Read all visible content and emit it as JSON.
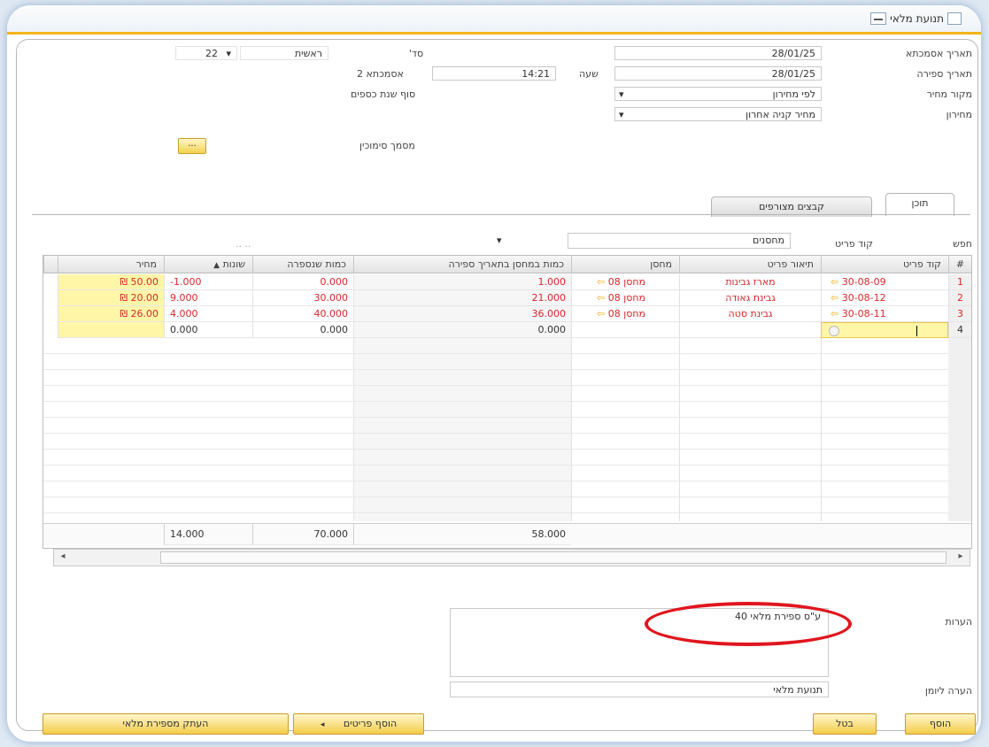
{
  "window": {
    "title": "תנועת מלאי"
  },
  "header": {
    "posting_date_label": "תאריך אסמכתא",
    "posting_date": "28/01/25",
    "count_date_label": "תאריך ספירה",
    "count_date": "28/01/25",
    "price_source_label": "מקור מחיר",
    "price_source": "לפי מחירון",
    "price_list_label": "מחירון",
    "price_list": "מחיר קניה אחרון",
    "time_label": "שעה",
    "time": "14:21",
    "series_label": "סד'",
    "series_value": "ראשית",
    "number": "22",
    "ref2_label": "אסמכתא 2",
    "fiscal_close": "סוף שנת כספים",
    "doc_ref_label": "מסמך סימוכין",
    "ellipsis": "..."
  },
  "tabs": [
    {
      "label": "תוכן"
    },
    {
      "label": "קבצים מצורפים"
    }
  ],
  "filter": {
    "find_label": "חפש",
    "item_code_label": "קוד פריט",
    "warehouses_label": "מחסנים",
    "dots": ".. .."
  },
  "grid": {
    "columns": {
      "num": "#",
      "item_code": "קוד פריט",
      "description": "תיאור פריט",
      "warehouse": "מחסן",
      "qty_on_date": "כמות במחסן בתאריך ספירה",
      "counted": "כמות שנספרה",
      "variance": "שונות",
      "price": "מחיר"
    },
    "rows": [
      {
        "num": "1",
        "item_code": "30-08-09",
        "description": "מארז גבינות",
        "warehouse": "מחסן 08",
        "qty_on_date": "1.000",
        "counted": "0.000",
        "variance": "-1.000",
        "price": "₪ 50.00"
      },
      {
        "num": "2",
        "item_code": "30-08-12",
        "description": "גבינת גאודה",
        "warehouse": "מחסן 08",
        "qty_on_date": "21.000",
        "counted": "30.000",
        "variance": "9.000",
        "price": "₪ 20.00"
      },
      {
        "num": "3",
        "item_code": "30-08-11",
        "description": "גבינת סטה",
        "warehouse": "מחסן 08",
        "qty_on_date": "36.000",
        "counted": "40.000",
        "variance": "4.000",
        "price": "₪ 26.00"
      },
      {
        "num": "4",
        "item_code": "",
        "description": "",
        "warehouse": "",
        "qty_on_date": "0.000",
        "counted": "0.000",
        "variance": "0.000",
        "price": ""
      }
    ],
    "totals": {
      "qty_on_date": "58.000",
      "counted": "70.000",
      "variance": "14.000"
    }
  },
  "footer": {
    "remarks_label": "הערות",
    "remarks": "ע\"ס ספירת מלאי 40",
    "journal_label": "הערה ליומן",
    "journal": "תנועת מלאי"
  },
  "buttons": {
    "add": "הוסף",
    "cancel": "בטל",
    "add_items": "הוסף פריטים",
    "copy_from_count": "העתק מספירת מלאי"
  },
  "colors": {
    "accent": "#f4b41a",
    "highlight": "#e0161e",
    "negative_text": "#d9262b",
    "price_cell": "#fff6a8"
  }
}
